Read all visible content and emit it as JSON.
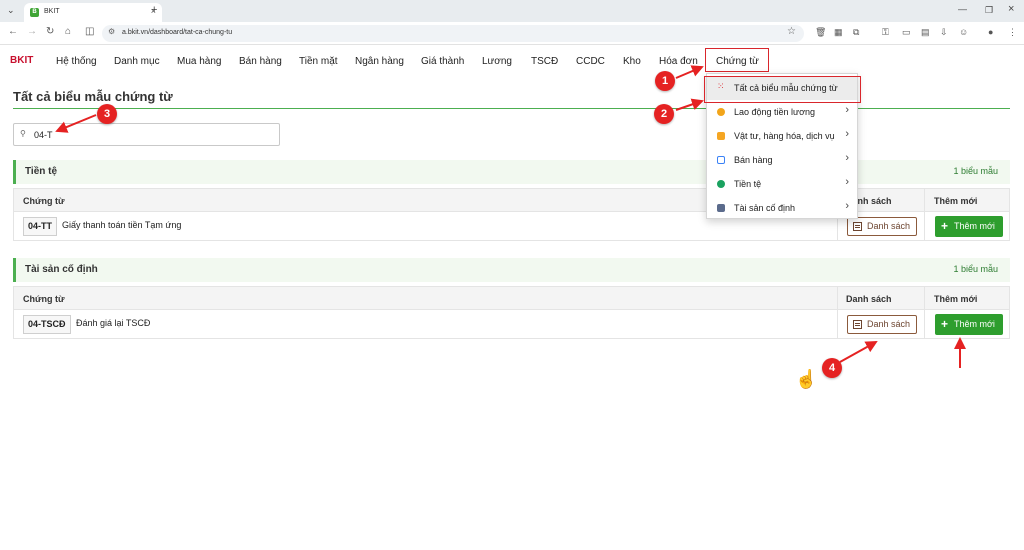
{
  "browser": {
    "tab_title": "BKIT",
    "tab_favicon": "B",
    "url": "a.bkit.vn/dashboard/tat-ca-chung-tu"
  },
  "nav": {
    "brand": "BKIT",
    "items": [
      "Hệ thống",
      "Danh mục",
      "Mua hàng",
      "Bán hàng",
      "Tiền mặt",
      "Ngân hàng",
      "Giá thành",
      "Lương",
      "TSCĐ",
      "CCDC",
      "Kho",
      "Hóa đơn"
    ],
    "active_item": "Chứng từ"
  },
  "dropdown": {
    "items": [
      {
        "label": "Tất cả biểu mẫu chứng từ",
        "icon": "grid-icon",
        "submenu": false
      },
      {
        "label": "Lao động tiền lương",
        "icon": "users-icon",
        "submenu": true
      },
      {
        "label": "Vật tư, hàng hóa, dịch vụ",
        "icon": "box-icon",
        "submenu": true
      },
      {
        "label": "Bán hàng",
        "icon": "calendar-icon",
        "submenu": true
      },
      {
        "label": "Tiền tệ",
        "icon": "coin-icon",
        "submenu": true
      },
      {
        "label": "Tài sản cố định",
        "icon": "building-icon",
        "submenu": true
      }
    ]
  },
  "page": {
    "title": "Tất cả biểu mẫu chứng từ",
    "search_value": "04-T"
  },
  "groups": [
    {
      "name": "Tiền tệ",
      "count": "1 biểu mẫu",
      "col_doc": "Chứng từ",
      "col_list": "Danh sách",
      "col_add": "Thêm mới",
      "rows": [
        {
          "code": "04-TT",
          "name": "Giấy thanh toán tiền Tạm ứng",
          "list_label": "Danh sách",
          "add_label": "Thêm mới"
        }
      ]
    },
    {
      "name": "Tài sản cố định",
      "count": "1 biểu mẫu",
      "col_doc": "Chứng từ",
      "col_list": "Danh sách",
      "col_add": "Thêm mới",
      "rows": [
        {
          "code": "04-TSCĐ",
          "name": "Đánh giá lại TSCĐ",
          "list_label": "Danh sách",
          "add_label": "Thêm mới"
        }
      ]
    }
  ],
  "annotations": [
    "1",
    "2",
    "3",
    "4"
  ],
  "colors": {
    "brand": "#c8102e",
    "accent_green": "#2e9e2e",
    "highlight_red": "#d9262c"
  }
}
